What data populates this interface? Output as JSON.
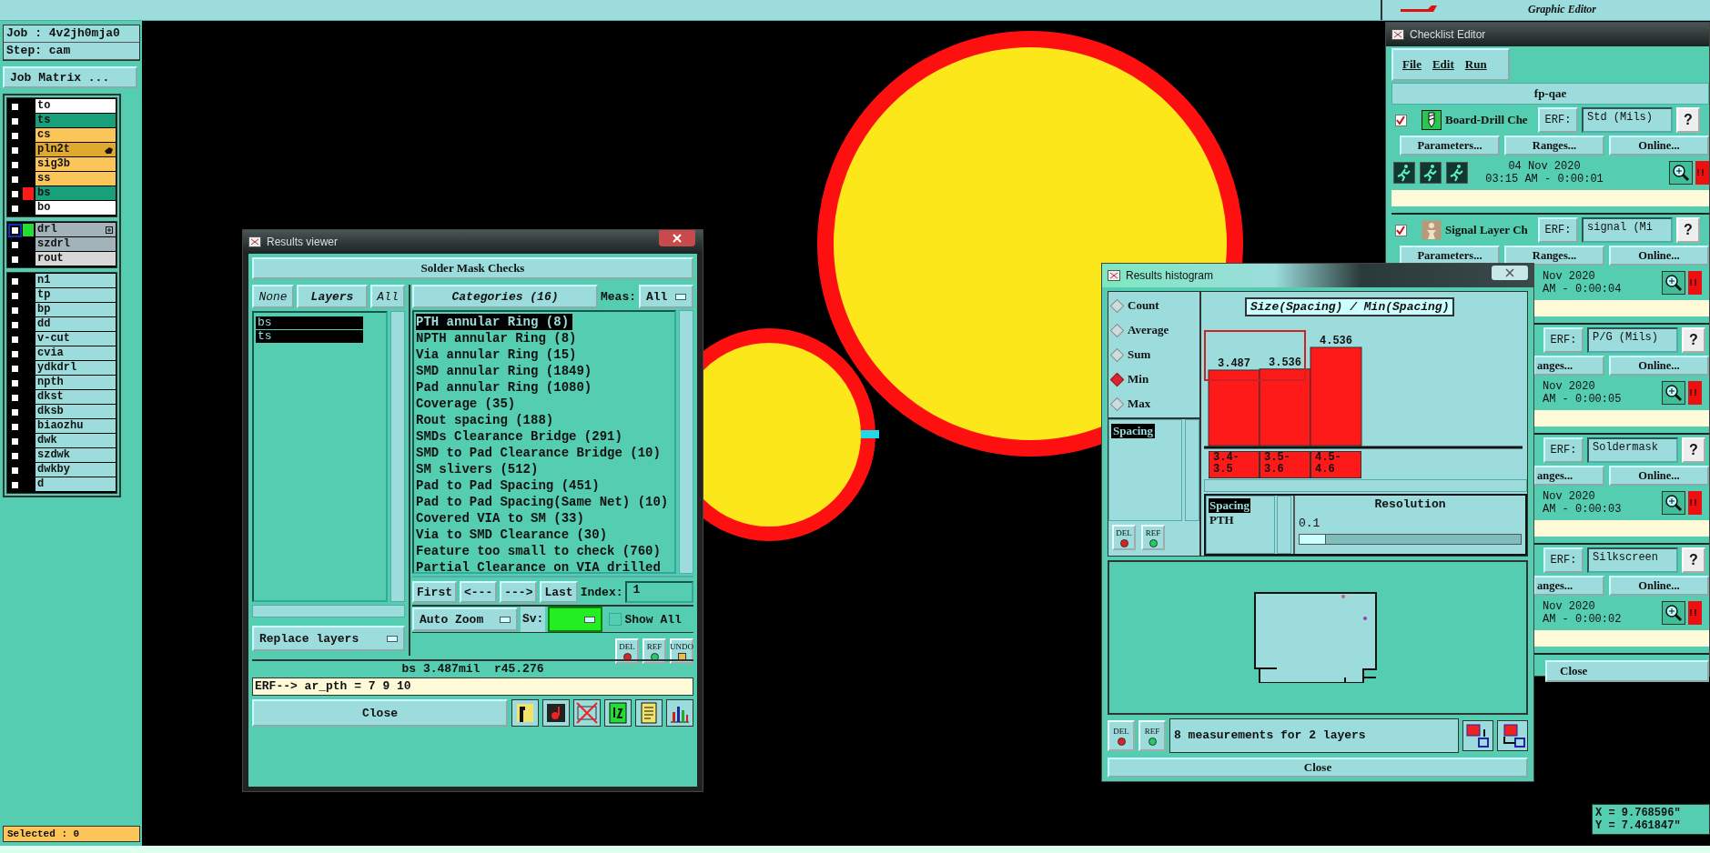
{
  "top_bar": {
    "subtitle": "Graphic Editor"
  },
  "job_panel": {
    "job": "Job : 4v2jh0mja0",
    "step": "Step: cam",
    "matrix_button": "Job Matrix ...",
    "selected_count": "Selected : 0"
  },
  "layer_groups": [
    {
      "layers": [
        {
          "name": "to",
          "kind": "plain",
          "color": "#ffffff",
          "checked": false,
          "affected": false
        },
        {
          "name": "ts",
          "kind": "plain",
          "color": "#17a07a",
          "checked": false,
          "affected": false
        },
        {
          "name": "cs",
          "kind": "plain",
          "color": "#fcc55a",
          "checked": false,
          "affected": false
        },
        {
          "name": "pln2t",
          "kind": "pointer",
          "color": "#e0a82c",
          "checked": false,
          "affected": false
        },
        {
          "name": "sig3b",
          "kind": "plain",
          "color": "#fcc55a",
          "checked": false,
          "affected": false
        },
        {
          "name": "ss",
          "kind": "plain",
          "color": "#fcc55a",
          "checked": false,
          "affected": false
        },
        {
          "name": "bs",
          "kind": "plain",
          "color": "#17a07a",
          "checked": false,
          "affected": false,
          "swatch": {
            "color": "#ff1a1a"
          }
        },
        {
          "name": "bo",
          "kind": "plain",
          "color": "#ffffff",
          "checked": false,
          "affected": false
        }
      ]
    },
    {
      "layers": [
        {
          "name": "drl",
          "kind": "plus",
          "color": "#a3b3ba",
          "checked": false,
          "affected": true,
          "swatch": {
            "color": "#22dd33"
          }
        },
        {
          "name": "szdrl",
          "kind": "plain",
          "color": "#a3b3ba",
          "checked": false,
          "affected": false
        },
        {
          "name": "rout",
          "kind": "plain",
          "color": "#d8d8d8",
          "checked": false,
          "affected": false
        }
      ]
    },
    {
      "layers": [
        {
          "name": "n1",
          "kind": "plain",
          "color": "#9cdcdc",
          "checked": false,
          "affected": false
        },
        {
          "name": "tp",
          "kind": "plain",
          "color": "#9cdcdc",
          "checked": false,
          "affected": false
        },
        {
          "name": "bp",
          "kind": "plain",
          "color": "#9cdcdc",
          "checked": false,
          "affected": false
        },
        {
          "name": "dd",
          "kind": "plain",
          "color": "#9cdcdc",
          "checked": false,
          "affected": false
        },
        {
          "name": "v-cut",
          "kind": "plain",
          "color": "#9cdcdc",
          "checked": false,
          "affected": false
        },
        {
          "name": "cvia",
          "kind": "plain",
          "color": "#9cdcdc",
          "checked": false,
          "affected": false
        },
        {
          "name": "ydkdrl",
          "kind": "plain",
          "color": "#9cdcdc",
          "checked": false,
          "affected": false
        },
        {
          "name": "npth",
          "kind": "plain",
          "color": "#9cdcdc",
          "checked": false,
          "affected": false
        },
        {
          "name": "dkst",
          "kind": "plain",
          "color": "#9cdcdc",
          "checked": false,
          "affected": false
        },
        {
          "name": "dksb",
          "kind": "plain",
          "color": "#9cdcdc",
          "checked": false,
          "affected": false
        },
        {
          "name": "biaozhu",
          "kind": "plain",
          "color": "#9cdcdc",
          "checked": false,
          "affected": false
        },
        {
          "name": "dwk",
          "kind": "plain",
          "color": "#9cdcdc",
          "checked": false,
          "affected": false
        },
        {
          "name": "szdwk",
          "kind": "plain",
          "color": "#9cdcdc",
          "checked": false,
          "affected": false
        },
        {
          "name": "dwkby",
          "kind": "plain",
          "color": "#9cdcdc",
          "checked": false,
          "affected": false
        },
        {
          "name": "d",
          "kind": "plain",
          "color": "#9cdcdc",
          "checked": false,
          "affected": false
        }
      ]
    }
  ],
  "coordinates": {
    "x": "X = 9.768596\"",
    "y": "Y = 7.461847\""
  },
  "results_viewer": {
    "title": "Results viewer",
    "heading": "Solder Mask Checks",
    "layer_buttons": [
      "None",
      "Layers",
      "All"
    ],
    "layers": [
      {
        "name": "bs",
        "selected": true
      },
      {
        "name": "ts",
        "selected": true
      }
    ],
    "categories_button": "Categories (16)",
    "meas_label": "Meas:",
    "meas_value": "All",
    "categories": [
      {
        "label": "PTH annular Ring (8)",
        "selected": true
      },
      {
        "label": "NPTH annular Ring (8)",
        "selected": false
      },
      {
        "label": "Via annular Ring (15)",
        "selected": false
      },
      {
        "label": "SMD annular Ring (1849)",
        "selected": false
      },
      {
        "label": "Pad annular Ring (1080)",
        "selected": false
      },
      {
        "label": "Coverage (35)",
        "selected": false
      },
      {
        "label": "Rout spacing (188)",
        "selected": false
      },
      {
        "label": "SMDs Clearance Bridge (291)",
        "selected": false
      },
      {
        "label": "SMD to Pad Clearance Bridge (10)",
        "selected": false
      },
      {
        "label": "SM slivers (512)",
        "selected": false
      },
      {
        "label": "Pad to Pad Spacing (451)",
        "selected": false
      },
      {
        "label": "Pad to Pad Spacing(Same Net) (10)",
        "selected": false
      },
      {
        "label": "Covered VIA to SM (33)",
        "selected": false
      },
      {
        "label": "Via to SMD Clearance (30)",
        "selected": false
      },
      {
        "label": "Feature too small to check (760)",
        "selected": false
      },
      {
        "label": "Partial Clearance on VIA drilled",
        "selected": false
      }
    ],
    "nav_buttons": [
      "First",
      "<---",
      "--->",
      "Last"
    ],
    "index_label": "Index:",
    "index_value": "1",
    "auto_zoom": "Auto Zoom",
    "sv": {
      "label": "Sv:",
      "color": "#22ee22"
    },
    "show_all": {
      "label": "Show All",
      "checked": false
    },
    "replace_layers": "Replace layers",
    "marker_buttons": [
      "DEL",
      "REF",
      "UNDO"
    ],
    "status": "bs 3.487mil  r45.276",
    "erf_line": "ERF--> ar_pth = 7 9 10",
    "close": "Close"
  },
  "results_histogram": {
    "title": "Results histogram",
    "modes": [
      {
        "label": "Count",
        "selected": false
      },
      {
        "label": "Average",
        "selected": false
      },
      {
        "label": "Sum",
        "selected": false
      },
      {
        "label": "Min",
        "selected": true
      },
      {
        "label": "Max",
        "selected": false
      }
    ],
    "measures": [
      {
        "label": "Spacing",
        "selected": true
      }
    ],
    "side_buttons": [
      "DEL",
      "REF"
    ],
    "chart_data": {
      "type": "bar",
      "title": "Size(Spacing) / Min(Spacing)",
      "categories": [
        "3.4-3.5",
        "3.5-3.6",
        "4.5-4.6"
      ],
      "values": [
        3.487,
        3.536,
        4.536
      ],
      "data_labels": true
    },
    "sub_list": [
      {
        "label": "Spacing",
        "selected": true
      },
      {
        "label": "PTH",
        "selected": false
      }
    ],
    "resolution_label": "Resolution",
    "resolution_value": "0.1",
    "resolution_slider": {
      "level": 0.0
    },
    "footer_buttons": [
      "DEL",
      "REF"
    ],
    "summary": "8 measurements for 2 layers",
    "close": "Close"
  },
  "checklist_editor": {
    "title": "Checklist Editor",
    "menu": [
      "File",
      "Edit",
      "Run"
    ],
    "name": "fp-qae",
    "checks": [
      {
        "kind": "visible",
        "title": "Board-Drill Che",
        "checked": true,
        "erf_label": "ERF:",
        "erf": "Std (Mils)",
        "help": "?",
        "buttons": [
          "Parameters...",
          "Ranges...",
          "Online..."
        ],
        "date": "04 Nov 2020",
        "time": "03:15 AM - 0:00:01",
        "alert": "!!"
      },
      {
        "kind": "half",
        "title": "Signal Layer Ch",
        "checked": true,
        "erf_label": "ERF:",
        "erf": "signal (Mi",
        "help": "?",
        "buttons": [
          "Parameters...",
          "Ranges...",
          "Online..."
        ],
        "date": "Nov 2020",
        "time": "AM - 0:00:04",
        "alert": "!!"
      },
      {
        "kind": "covered",
        "erf_label": "ERF:",
        "erf": "P/G (Mils)",
        "help": "?",
        "buttons": [
          "anges...",
          "Online..."
        ],
        "date": "Nov 2020",
        "time": "AM - 0:00:05",
        "alert": "!!"
      },
      {
        "kind": "covered",
        "erf_label": "ERF:",
        "erf": "Soldermask",
        "help": "?",
        "buttons": [
          "anges...",
          "Online..."
        ],
        "date": "Nov 2020",
        "time": "AM - 0:00:03",
        "alert": "!!"
      },
      {
        "kind": "covered",
        "erf_label": "ERF:",
        "erf": "Silkscreen",
        "help": "?",
        "buttons": [
          "anges...",
          "Online..."
        ],
        "date": "Nov 2020",
        "time": "AM - 0:00:02",
        "alert": "!!"
      }
    ],
    "close": "Close"
  }
}
